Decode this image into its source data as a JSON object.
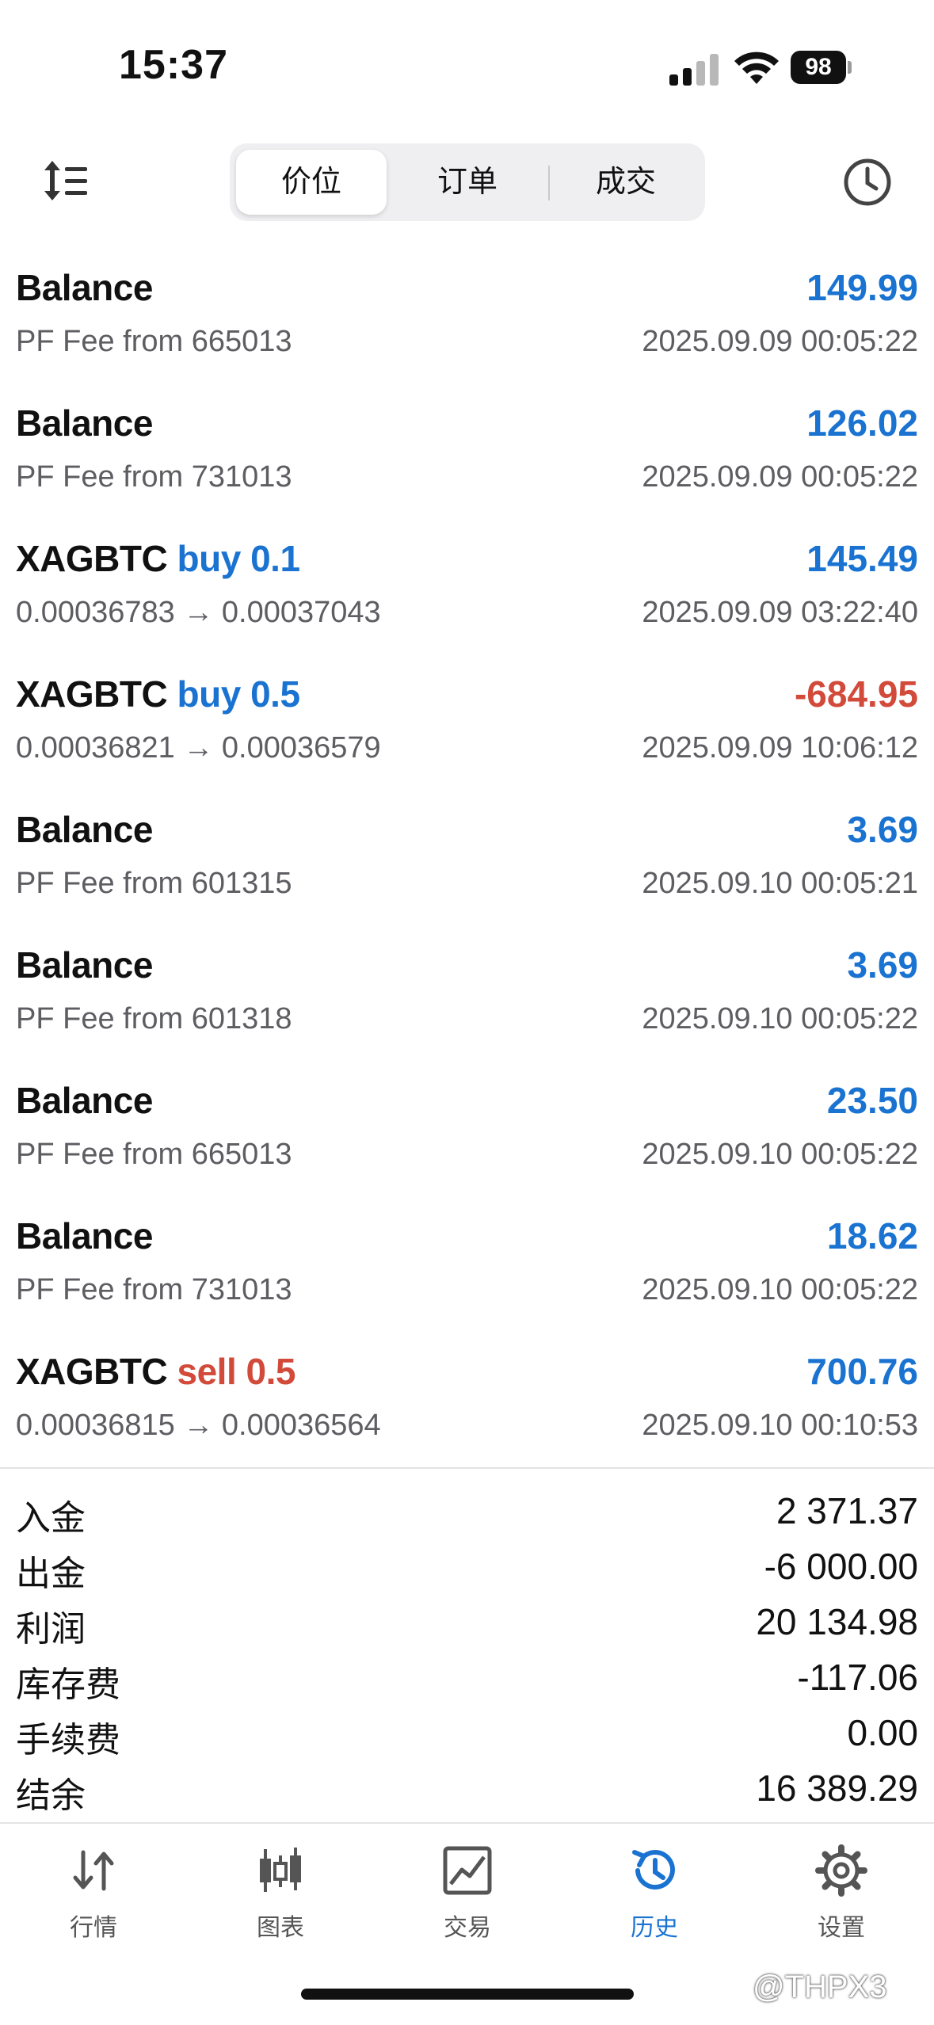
{
  "status_bar": {
    "time": "15:37",
    "battery": "98"
  },
  "toolbar": {
    "tabs": [
      {
        "label": "价位",
        "active": true
      },
      {
        "label": "订单",
        "active": false
      },
      {
        "label": "成交",
        "active": false
      }
    ],
    "icons": [
      "sort-icon",
      "clock-icon"
    ]
  },
  "deals": [
    {
      "symbol": "Balance",
      "side": "",
      "detail": "PF Fee from 665013",
      "amount": "149.99",
      "datetime": "2025.09.09 00:05:22"
    },
    {
      "symbol": "Balance",
      "side": "",
      "detail": "PF Fee from 731013",
      "amount": "126.02",
      "datetime": "2025.09.09 00:05:22"
    },
    {
      "symbol": "XAGBTC",
      "side": "buy 0.1",
      "detail": "0.00036783 → 0.00037043",
      "amount": "145.49",
      "datetime": "2025.09.09 03:22:40"
    },
    {
      "symbol": "XAGBTC",
      "side": "buy 0.5",
      "detail": "0.00036821 → 0.00036579",
      "amount": "-684.95",
      "datetime": "2025.09.09 10:06:12"
    },
    {
      "symbol": "Balance",
      "side": "",
      "detail": "PF Fee from 601315",
      "amount": "3.69",
      "datetime": "2025.09.10 00:05:21"
    },
    {
      "symbol": "Balance",
      "side": "",
      "detail": "PF Fee from 601318",
      "amount": "3.69",
      "datetime": "2025.09.10 00:05:22"
    },
    {
      "symbol": "Balance",
      "side": "",
      "detail": "PF Fee from 665013",
      "amount": "23.50",
      "datetime": "2025.09.10 00:05:22"
    },
    {
      "symbol": "Balance",
      "side": "",
      "detail": "PF Fee from 731013",
      "amount": "18.62",
      "datetime": "2025.09.10 00:05:22"
    },
    {
      "symbol": "XAGBTC",
      "side": "sell 0.5",
      "detail": "0.00036815 → 0.00036564",
      "amount": "700.76",
      "datetime": "2025.09.10 00:10:53"
    }
  ],
  "summary": [
    {
      "label": "入金",
      "value": "2 371.37"
    },
    {
      "label": "出金",
      "value": "-6 000.00"
    },
    {
      "label": "利润",
      "value": "20 134.98"
    },
    {
      "label": "库存费",
      "value": "-117.06"
    },
    {
      "label": "手续费",
      "value": "0.00"
    },
    {
      "label": "结余",
      "value": "16 389.29"
    }
  ],
  "tab_bar": [
    {
      "label": "行情",
      "icon": "arrows-icon",
      "active": false
    },
    {
      "label": "图表",
      "icon": "candlestick-icon",
      "active": false
    },
    {
      "label": "交易",
      "icon": "trade-chart-icon",
      "active": false
    },
    {
      "label": "历史",
      "icon": "history-icon",
      "active": true
    },
    {
      "label": "设置",
      "icon": "gear-icon",
      "active": false
    }
  ],
  "colors": {
    "accent": "#1a73d1",
    "negative": "#d24a3a",
    "muted": "#5d5d62"
  },
  "watermark": "@THPX3"
}
